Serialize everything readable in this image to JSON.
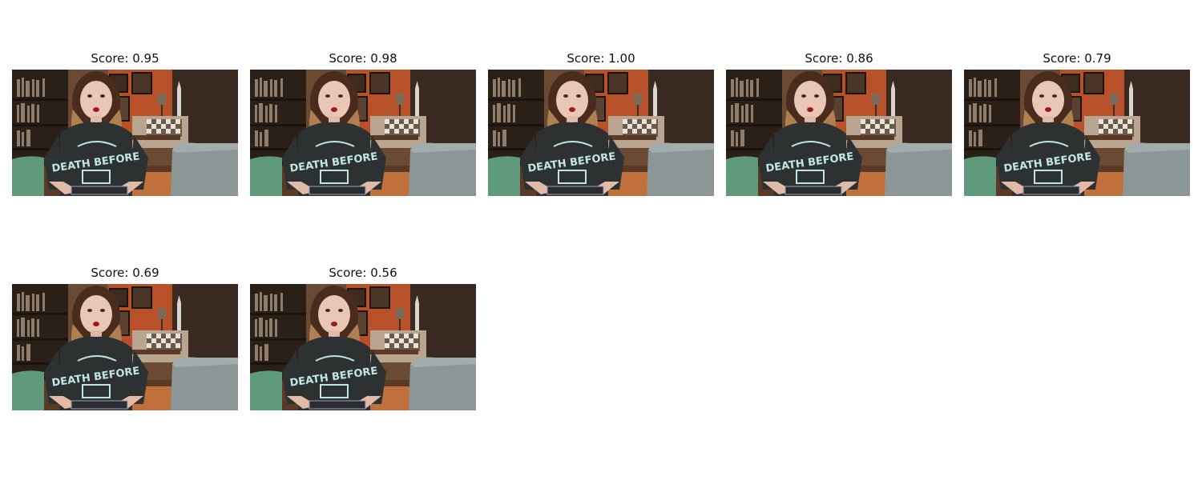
{
  "frames": [
    {
      "title": "Score: 0.95",
      "scene": "woman-video-frame"
    },
    {
      "title": "Score: 0.98",
      "scene": "woman-video-frame"
    },
    {
      "title": "Score: 1.00",
      "scene": "woman-video-frame"
    },
    {
      "title": "Score: 0.86",
      "scene": "woman-video-frame"
    },
    {
      "title": "Score: 0.79",
      "scene": "woman-video-frame"
    },
    {
      "title": "Score: 0.69",
      "scene": "woman-video-frame"
    },
    {
      "title": "Score: 0.56",
      "scene": "woman-video-frame"
    }
  ],
  "shirt_text": "DEATH BEFORE",
  "colors": {
    "wall": "#b8502a",
    "bookshelf": "#2b2018",
    "shirt": "#2e3132",
    "shirt_print": "#bfe6e4",
    "sofa_gray": "#8c9696",
    "chair_green": "#5f9a7c",
    "floor": "#c0703a"
  }
}
